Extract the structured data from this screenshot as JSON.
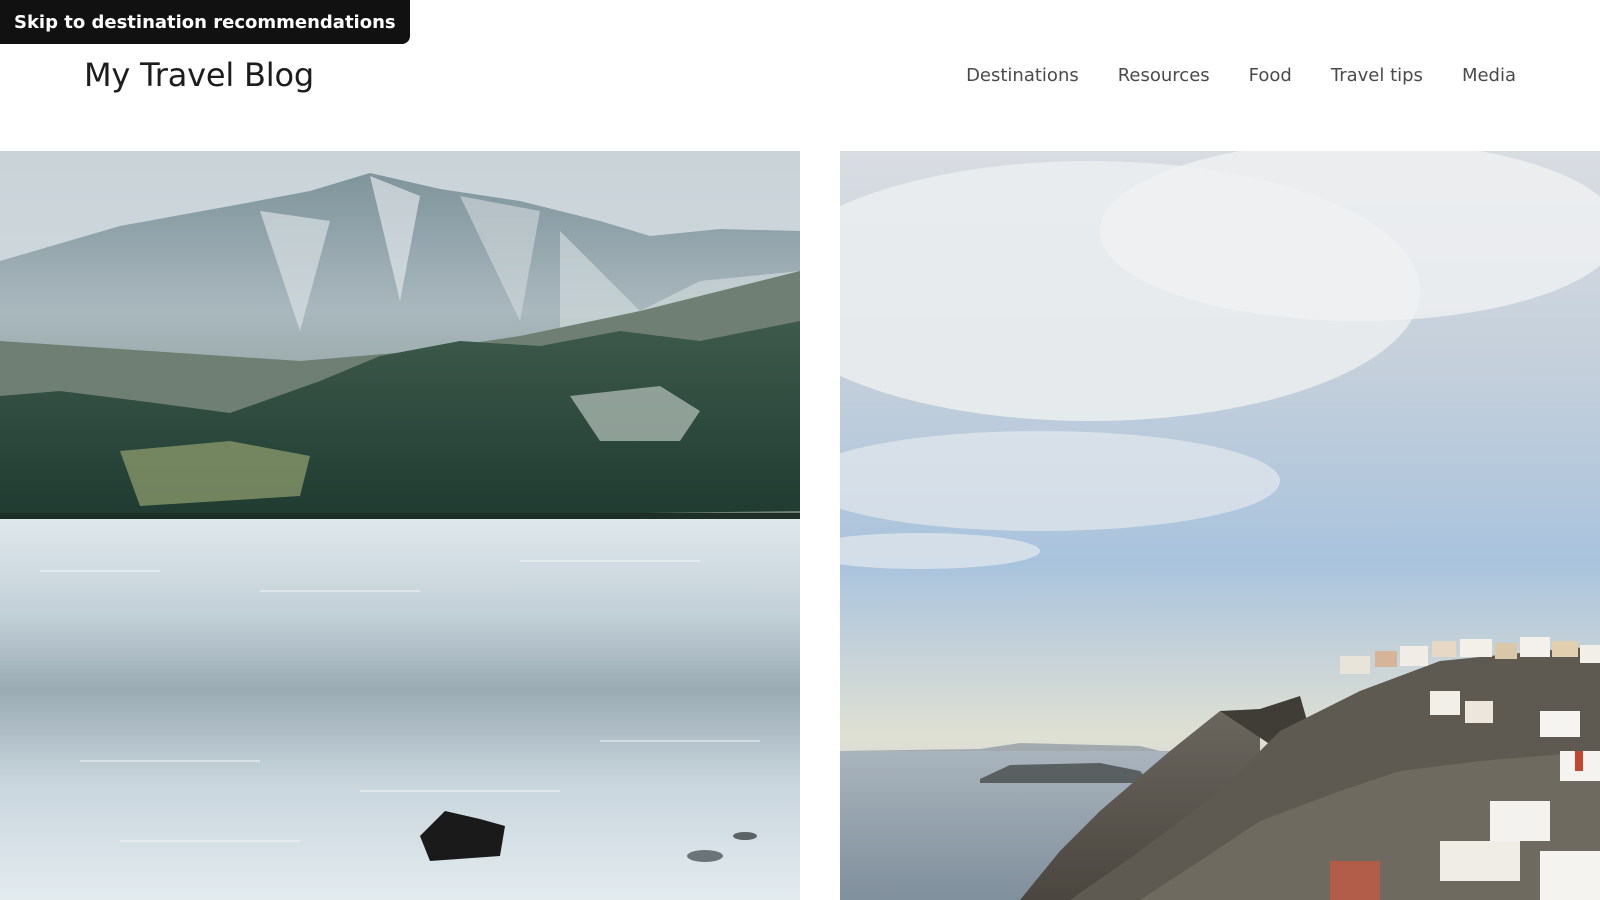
{
  "skip_link": {
    "label": "Skip to destination recommendations"
  },
  "site": {
    "title": "My Travel Blog"
  },
  "nav": {
    "items": [
      {
        "label": "Destinations"
      },
      {
        "label": "Resources"
      },
      {
        "label": "Food"
      },
      {
        "label": "Travel tips"
      },
      {
        "label": "Media"
      }
    ]
  },
  "gallery": {
    "photos": [
      {
        "subject": "mountain-lake"
      },
      {
        "subject": "coastal-cliff-village"
      }
    ]
  },
  "colors": {
    "skip_link_bg": "#111111",
    "title_text": "#1c1c1c",
    "nav_text": "#4a4a4a",
    "background": "#ffffff"
  }
}
